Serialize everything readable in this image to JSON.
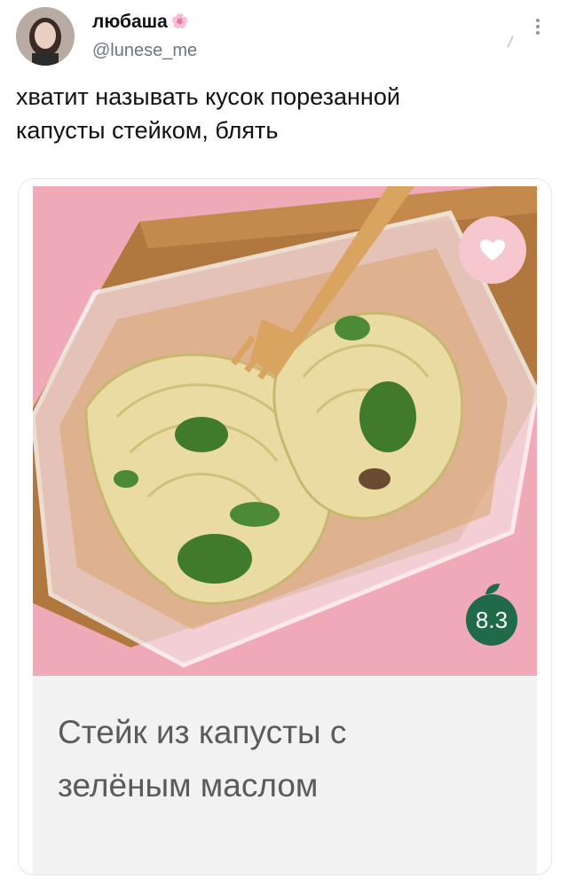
{
  "author": {
    "name": "любаша",
    "name_emoji": "🌸",
    "handle": "@lunese_me"
  },
  "tweet": {
    "text_line1": "хватит называть кусок порезанной",
    "text_line2": "капусты стейком, блять"
  },
  "card": {
    "rating": "8.3",
    "title_line1": "Стейк из капусты с",
    "title_line2": "зелёным маслом",
    "colors": {
      "photo_bg": "#f0aab7",
      "rating_bg": "#1f6a48",
      "caption_bg": "#f2f2f2"
    },
    "icons": [
      "heart-icon",
      "leaf-icon"
    ]
  },
  "icons": {
    "more": "more-vertical-icon"
  }
}
